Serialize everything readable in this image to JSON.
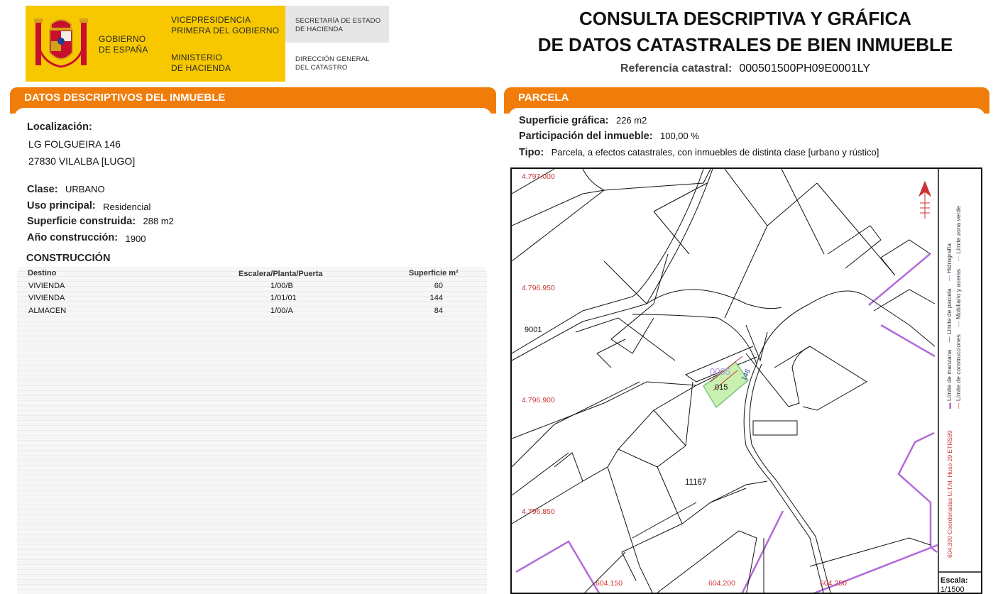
{
  "header": {
    "gov_line1": "GOBIERNO",
    "gov_line2": "DE ESPAÑA",
    "vp_line1": "VICEPRESIDENCIA",
    "vp_line2": "PRIMERA DEL GOBIERNO",
    "min_line1": "MINISTERIO",
    "min_line2": "DE HACIENDA",
    "sec_line1": "SECRETARÍA DE ESTADO",
    "sec_line2": "DE HACIENDA",
    "dir_line1": "DIRECCIÓN GENERAL",
    "dir_line2": "DEL CATASTRO",
    "title_line1": "CONSULTA DESCRIPTIVA Y GRÁFICA",
    "title_line2": "DE DATOS CATASTRALES DE BIEN INMUEBLE",
    "ref_label": "Referencia catastral:",
    "ref_value": "000501500PH09E0001LY"
  },
  "left": {
    "section_title": "DATOS DESCRIPTIVOS DEL INMUEBLE",
    "localizacion_label": "Localización:",
    "address_line1": "LG FOLGUEIRA 146",
    "address_line2": "27830 VILALBA [LUGO]",
    "clase_label": "Clase:",
    "clase_value": "URBANO",
    "uso_label": "Uso principal:",
    "uso_value": "Residencial",
    "sup_label": "Superficie construida:",
    "sup_value": "288 m2",
    "anio_label": "Año construcción:",
    "anio_value": "1900",
    "construccion_title": "CONSTRUCCIÓN",
    "table": {
      "headers": [
        "Destino",
        "Escalera/Planta/Puerta",
        "Superficie m²"
      ],
      "rows": [
        [
          "VIVIENDA",
          "1/00/B",
          "60"
        ],
        [
          "VIVIENDA",
          "1/01/01",
          "144"
        ],
        [
          "ALMACEN",
          "1/00/A",
          "84"
        ]
      ]
    }
  },
  "right": {
    "section_title": "PARCELA",
    "sup_grafica_label": "Superficie gráfica:",
    "sup_grafica_value": "226 m2",
    "participacion_label": "Participación del inmueble:",
    "participacion_value": "100,00 %",
    "tipo_label": "Tipo:",
    "tipo_value": "Parcela, a efectos catastrales, con inmuebles de distinta clase [urbano y rústico]"
  },
  "map": {
    "y_coords": [
      "4.797.000",
      "4.796.950",
      "4.796.900",
      "4.796.850"
    ],
    "x_coords": [
      "604.150",
      "604.200",
      "604.250"
    ],
    "parcel_labels": [
      "9001",
      "0005",
      "015",
      "146",
      "11167"
    ],
    "legend": [
      "Límite de manzana",
      "Límite de parcela",
      "Hidrografía",
      "Límite de construcciones",
      "Mobiliario y aceras",
      "Límite zona verde"
    ],
    "coord_note": "604.300 Coordenadas U.T.M. Huso 29 ETRS89",
    "scale_label": "Escala:",
    "scale_value": "1/1500",
    "colors": {
      "manzana": "#b36ad9",
      "parcela": "#111111",
      "construcciones": "#c33333",
      "zona_verde": "#7cc47c",
      "highlight": "#c8f0b0"
    }
  }
}
